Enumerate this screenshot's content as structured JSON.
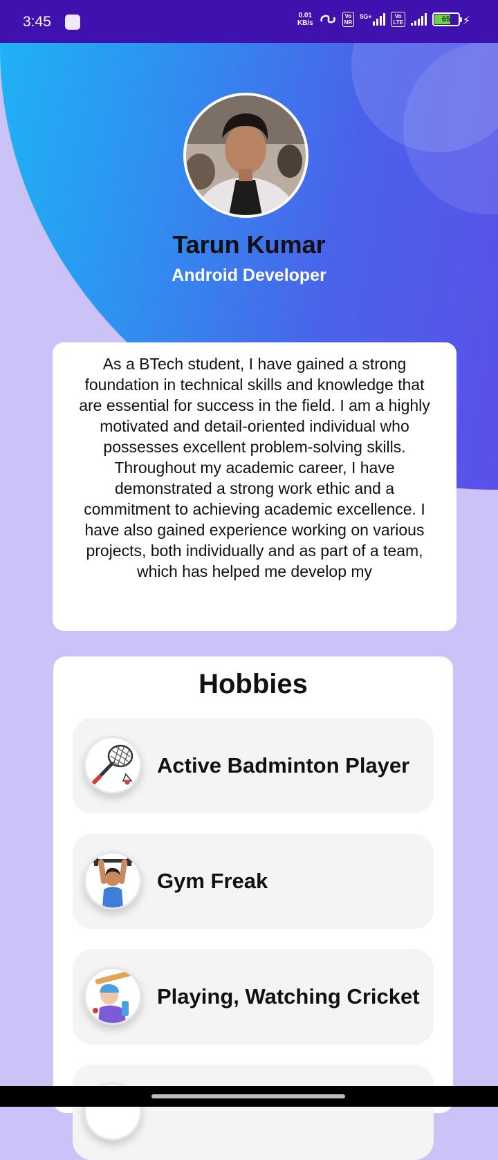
{
  "status_bar": {
    "time": "3:45",
    "net_speed_value": "0.01",
    "net_speed_unit": "KB/s",
    "badge_1": "Vo NR",
    "badge_1_top": "Vo",
    "badge_1_bottom": "NR",
    "network_type": "5G+",
    "badge_2_top": "Vo",
    "badge_2_bottom": "LTE",
    "battery_level": "65",
    "battery_fraction": 0.65,
    "battery_color": "#6fd14a"
  },
  "profile": {
    "name": "Tarun Kumar",
    "role": "Android Developer",
    "avatar_icon": "profile-photo"
  },
  "about": {
    "text": "As a BTech student, I have gained a strong foundation in technical skills and knowledge that are essential for success in the field. I am a highly motivated and detail-oriented individual who possesses excellent problem-solving skills. Throughout my academic career, I have demonstrated a strong work ethic and a commitment to achieving academic excellence. I have also gained experience working on various projects, both individually and as part of a team, which has helped me develop my"
  },
  "hobbies": {
    "title": "Hobbies",
    "items": [
      {
        "label": "Active Badminton Player",
        "icon": "badminton-icon"
      },
      {
        "label": "Gym Freak",
        "icon": "gym-icon"
      },
      {
        "label": "Playing, Watching Cricket",
        "icon": "cricket-icon"
      }
    ]
  },
  "colors": {
    "status_bar": "#3f12b0",
    "gradient_start": "#1fb2f5",
    "gradient_end": "#5a50e8",
    "page_background": "#cbc3f7"
  }
}
